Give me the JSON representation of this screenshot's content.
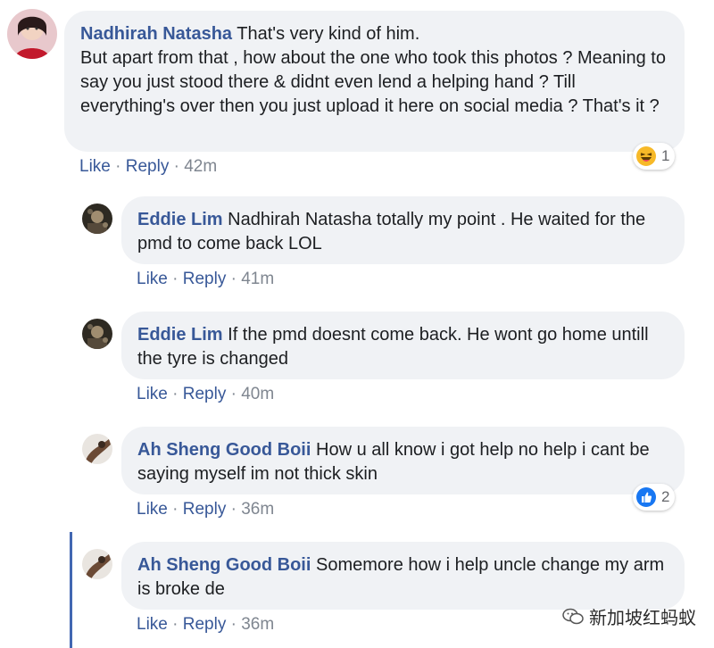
{
  "comments": [
    {
      "name": "Nadhirah Natasha",
      "text": "That's very kind of him.\nBut apart from that , how about the one who took this photos ? Meaning to say you just stood there & didnt even lend a helping hand ? Till everything's over then you just upload it here on social media ? That's it ?",
      "like": "Like",
      "reply": "Reply",
      "time": "42m",
      "reaction_icon": "haha-emoji-icon",
      "reaction_count": "1"
    },
    {
      "name": "Eddie Lim",
      "text": "Nadhirah Natasha totally my point . He waited for the pmd to come back LOL",
      "like": "Like",
      "reply": "Reply",
      "time": "41m"
    },
    {
      "name": "Eddie Lim",
      "text": "If the pmd doesnt come back. He wont go home untill the tyre is changed",
      "like": "Like",
      "reply": "Reply",
      "time": "40m"
    },
    {
      "name": "Ah Sheng Good Boii",
      "text": "How u all know i got help no help i cant be saying myself im not thick skin",
      "like": "Like",
      "reply": "Reply",
      "time": "36m",
      "reaction_icon": "thumbs-up-icon",
      "reaction_count": "2"
    },
    {
      "name": "Ah Sheng Good Boii",
      "text": "Somemore how i help uncle change my arm is broke de",
      "like": "Like",
      "reply": "Reply",
      "time": "36m"
    }
  ],
  "separator": "·",
  "watermark": "新加坡红蚂蚁",
  "colors": {
    "name": "#385898",
    "bubble": "#f0f2f5",
    "meta_link": "#385898",
    "thread_line": "#4267b2"
  }
}
